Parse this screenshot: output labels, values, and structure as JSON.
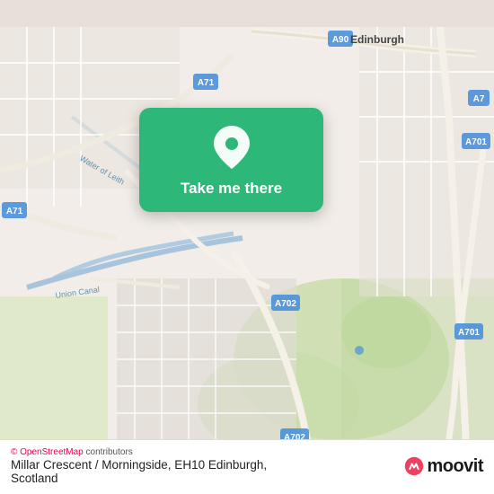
{
  "map": {
    "attribution": "© OpenStreetMap contributors",
    "attribution_link": "OpenStreetMap",
    "location_name": "Millar Crescent / Morningside, EH10 Edinburgh,",
    "location_sub": "Scotland"
  },
  "card": {
    "button_label": "Take me there",
    "icon": "location-pin-icon"
  },
  "moovit": {
    "logo_text": "moovit"
  },
  "road_labels": {
    "a90": "A90",
    "a7": "A7",
    "a71_top": "A71",
    "a71_left": "A71",
    "a701_right_top": "A701",
    "a701_right_mid": "A701",
    "a702_mid": "A702",
    "a702_bottom": "A702",
    "union_canal": "Union Canal",
    "water_leith": "Water of Leith"
  }
}
